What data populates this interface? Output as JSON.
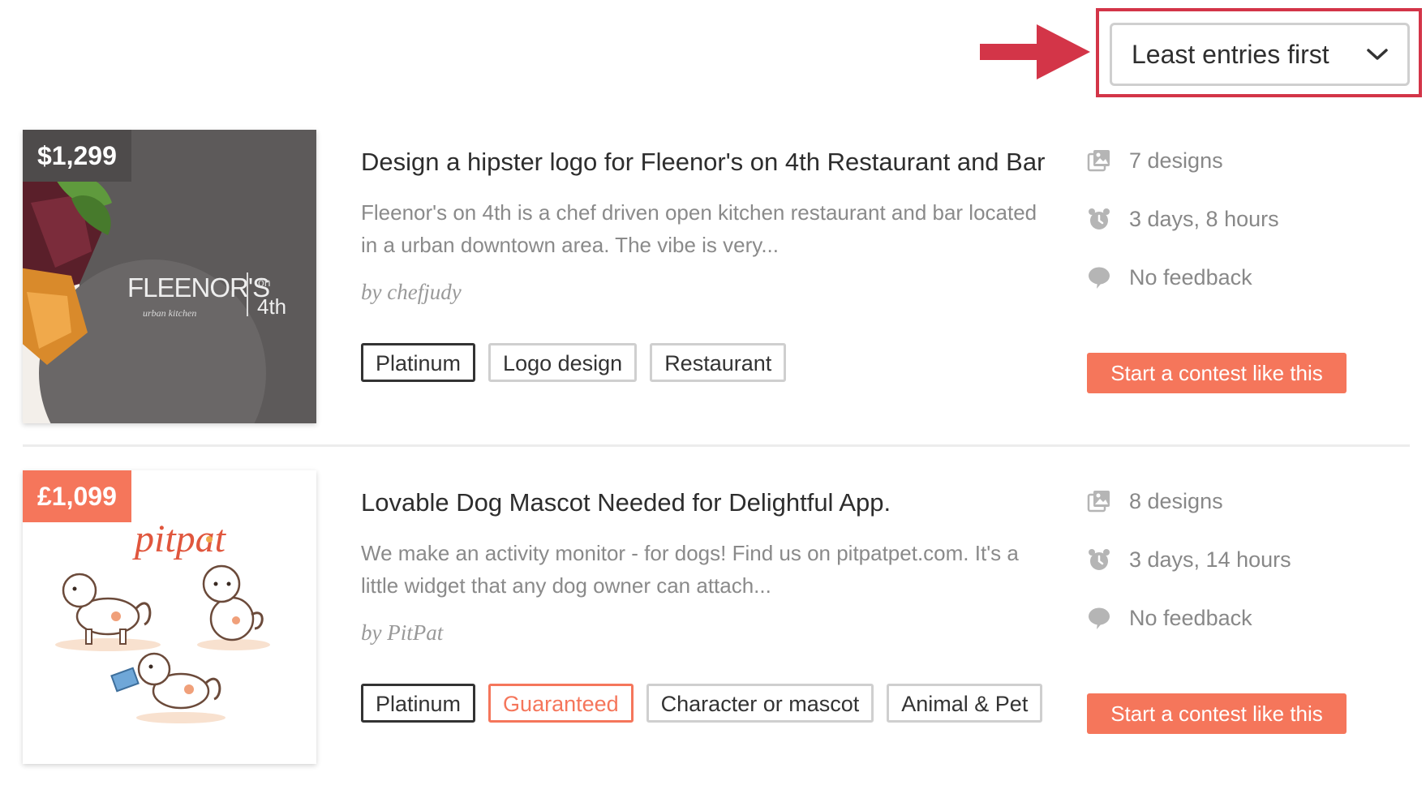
{
  "sort": {
    "selected": "Least entries first"
  },
  "colors": {
    "accent": "#f5765b",
    "highlight": "#d33548",
    "price_dark": "#4e4b4b"
  },
  "contests": [
    {
      "price": "$1,299",
      "price_style": "dark",
      "thumbnail": {
        "brand_name": "FLEENOR'S",
        "brand_sub": "urban kitchen",
        "brand_on": "on",
        "brand_num": "4th"
      },
      "title": "Design a hipster logo for Fleenor's on 4th Restaurant and Bar",
      "description": "Fleenor's on 4th is a chef driven open kitchen restaurant and bar located in a urban downtown area. The vibe is very...",
      "author": "by chefjudy",
      "tags": [
        {
          "label": "Platinum",
          "style": "strong"
        },
        {
          "label": "Logo design",
          "style": "default"
        },
        {
          "label": "Restaurant",
          "style": "default"
        }
      ],
      "stats": {
        "designs": "7 designs",
        "time_left": "3 days, 8 hours",
        "feedback": "No feedback"
      },
      "cta": "Start a contest like this"
    },
    {
      "price": "£1,099",
      "price_style": "coral",
      "thumbnail": {
        "brand_name": "pitpat"
      },
      "title": "Lovable Dog Mascot Needed for Delightful App.",
      "description": "We make an activity monitor - for dogs! Find us on pitpatpet.com. It's a little widget that any dog owner can attach...",
      "author": "by PitPat",
      "tags": [
        {
          "label": "Platinum",
          "style": "strong"
        },
        {
          "label": "Guaranteed",
          "style": "coral"
        },
        {
          "label": "Character or mascot",
          "style": "default"
        },
        {
          "label": "Animal & Pet",
          "style": "default"
        }
      ],
      "stats": {
        "designs": "8 designs",
        "time_left": "3 days, 14 hours",
        "feedback": "No feedback"
      },
      "cta": "Start a contest like this"
    }
  ]
}
